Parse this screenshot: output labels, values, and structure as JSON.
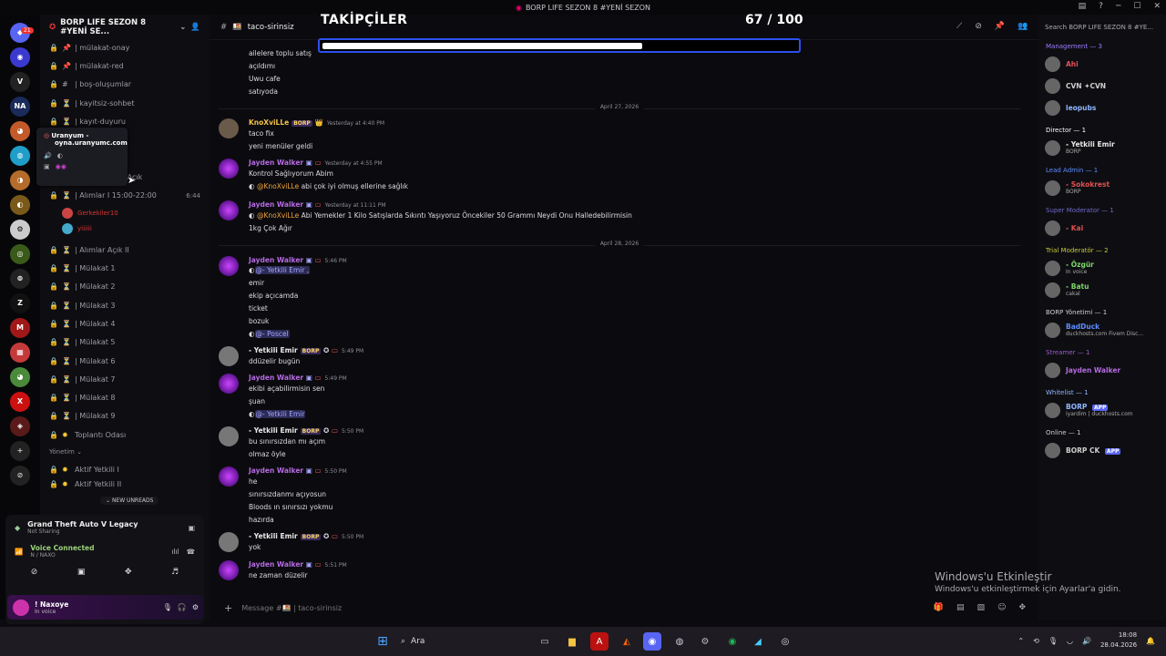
{
  "window_title": "BORP LIFE SEZON 8 #YENİ SEZON",
  "overlay": {
    "label": "TAKİPÇİLER",
    "count": "67 / 100",
    "progress_fraction": 0.67
  },
  "server": {
    "name": "BORP LIFE SEZON 8 #YENİ SE...",
    "badge": "21"
  },
  "channels": [
    {
      "icon": "📌",
      "name": "| mülakat-onay"
    },
    {
      "icon": "📌",
      "name": "| mülakat-red"
    },
    {
      "icon": "#",
      "name": "| boş-oluşumlar"
    },
    {
      "icon": "⏳",
      "name": "| kayitsiz-sohbet"
    },
    {
      "icon": "⏳",
      "name": "| kayıt-duyuru"
    }
  ],
  "tooltip": {
    "name": "Uranyum -",
    "url": "oyna.uranyumc.com"
  },
  "voice_channels": [
    {
      "name": "| Ekip Alımları Açık"
    },
    {
      "name": "| Alımlar I 15:00-22:00",
      "meta": "6:44"
    }
  ],
  "voice_users": [
    "Gerkekiler10",
    "yiiiiii"
  ],
  "voice_channels2": [
    "| Alımlar Açık II",
    "| Mülakat 1",
    "| Mülakat 2",
    "| Mülakat 3",
    "| Mülakat 4",
    "| Mülakat 5",
    "| Mülakat 6",
    "| Mülakat 7",
    "| Mülakat 8",
    "| Mülakat 9",
    "Toplantı Odası"
  ],
  "section_yonetim": "Yönetim",
  "yonetim_channels": [
    "Aktif Yetkili I",
    "Aktif Yetkili II"
  ],
  "new_unreads": "NEW UNREADS",
  "activity": {
    "game": "Grand Theft Auto V Legacy",
    "sub": "Not Sharing"
  },
  "voice_status": {
    "title": "Voice Connected",
    "sub": "N / NAXO"
  },
  "user": {
    "name": "! Naxoye",
    "status": "In voice"
  },
  "current_channel": "taco-sirinsiz",
  "messages": [
    {
      "id": "m0",
      "lines": [
        "ailelere toplu satış",
        "açıldımı",
        "Uwu cafe",
        "satıyoda"
      ]
    },
    {
      "id": "m1",
      "author": "KnoXviLLe",
      "tag": "BORP",
      "time": "Yesterday at 4:40 PM",
      "lines": [
        "taco fix",
        "yeni menüler geldi"
      ]
    },
    {
      "id": "m2",
      "author": "Jayden Walker",
      "time": "Yesterday at 4:55 PM",
      "lines": [
        "Kontrol Sağlıyorum Abim"
      ],
      "reply_mention": "@KnoXviLLe",
      "reply_text": " abi çok iyi olmuş ellerine sağlık"
    },
    {
      "id": "m3",
      "author": "Jayden Walker",
      "time": "Yesterday at 11:11 PM",
      "reply_mention": "@KnoXviLLe",
      "reply_text": " Abi Yemekler 1 Kilo Satışlarda Sıkıntı Yaşıyoruz Öncekiler 50 Grammı Neydi Onu Halledebilirmisin",
      "lines": [
        "1kg Çok Ağır"
      ]
    },
    {
      "id": "m4",
      "author": "Jayden Walker",
      "time": "5:46 PM",
      "mention_top": "@- Yetkili Emir ,",
      "lines": [
        "emir",
        "ekip açıcamda",
        "ticket",
        "bozuk"
      ],
      "mention_bottom": "@- Poscel"
    },
    {
      "id": "m5",
      "author": "- Yetkili Emir",
      "tag": "BORP",
      "time": "5:49 PM",
      "lines": [
        "ddüzelir bugün"
      ]
    },
    {
      "id": "m6",
      "author": "Jayden Walker",
      "time": "5:49 PM",
      "lines": [
        "ekibi açabilirmisin sen",
        "şuan"
      ],
      "mention_bottom": "@- Yetkili Emir"
    },
    {
      "id": "m7",
      "author": "- Yetkili Emir",
      "tag": "BORP",
      "time": "5:50 PM",
      "lines": [
        "bu sınırsızdan mı açım",
        "olmaz öyle"
      ]
    },
    {
      "id": "m8",
      "author": "Jayden Walker",
      "time": "5:50 PM",
      "lines": [
        "he",
        "sınırsızdanmı açıyosun",
        "Bloods ın sınırsızı yokmu",
        "hazırda"
      ]
    },
    {
      "id": "m9",
      "author": "- Yetkili Emir",
      "tag": "BORP",
      "time": "5:50 PM",
      "lines": [
        "yok"
      ]
    },
    {
      "id": "m10",
      "author": "Jayden Walker",
      "time": "5:51 PM",
      "lines": [
        "ne zaman düzelir"
      ]
    }
  ],
  "dates": [
    "April 27, 2026",
    "April 28, 2026"
  ],
  "composer_placeholder": "Message #🍱 | taco-sirinsiz",
  "members_search": "Search BORP LIFE SEZON 8 #YE...",
  "member_groups": [
    {
      "label": "Management — 3",
      "color": "#9b7bff",
      "members": [
        {
          "name": "Ahi",
          "color": "#e05060"
        },
        {
          "name": "CVN ✦CVN",
          "color": "#cfcfcf"
        },
        {
          "name": "leopubs",
          "color": "#8fb6ff"
        }
      ]
    },
    {
      "label": "Director — 1",
      "color": "#ffffff",
      "members": [
        {
          "name": "- Yetkili Emir",
          "color": "#e8e8e8",
          "sub": "BORP"
        }
      ]
    },
    {
      "label": "Lead Admin — 1",
      "color": "#5c8cff",
      "members": [
        {
          "name": "- Sokokrest",
          "color": "#e05050",
          "sub": "BORP"
        }
      ]
    },
    {
      "label": "Super Moderator — 1",
      "color": "#7068c9",
      "members": [
        {
          "name": "- Kai",
          "color": "#e05050"
        }
      ]
    },
    {
      "label": "Trial Moderatör — 2",
      "color": "#c9c93a",
      "members": [
        {
          "name": "- Özgür",
          "color": "#7fd66a",
          "sub": "In voice"
        },
        {
          "name": "- Batu",
          "color": "#7fd66a",
          "sub": "cakal"
        }
      ]
    },
    {
      "label": "BORP Yönetimi — 1",
      "color": "#cfcfcf",
      "members": [
        {
          "name": "BadDuck",
          "color": "#5c8cff",
          "sub": "duckhosts.com Fivem Disc..."
        }
      ]
    },
    {
      "label": "Streamer — 1",
      "color": "#9b5cc9",
      "members": [
        {
          "name": "Jayden Walker",
          "color": "#b56ae0"
        }
      ]
    },
    {
      "label": "Whitelist — 1",
      "color": "#8fb6ff",
      "members": [
        {
          "name": "BORP",
          "color": "#8fb6ff",
          "sub": "iyardim | duckhosts.com",
          "app": "APP"
        }
      ]
    },
    {
      "label": "Online — 1",
      "color": "#cfcfcf",
      "members": [
        {
          "name": "BORP CK",
          "color": "#cfcfcf",
          "app": "APP"
        }
      ]
    }
  ],
  "watermark": {
    "title": "Windows'u Etkinleştir",
    "sub": "Windows'u etkinleştirmek için Ayarlar'a gidin."
  },
  "taskbar": {
    "search": "Ara",
    "time": "18:08",
    "date": "28.04.2026"
  }
}
